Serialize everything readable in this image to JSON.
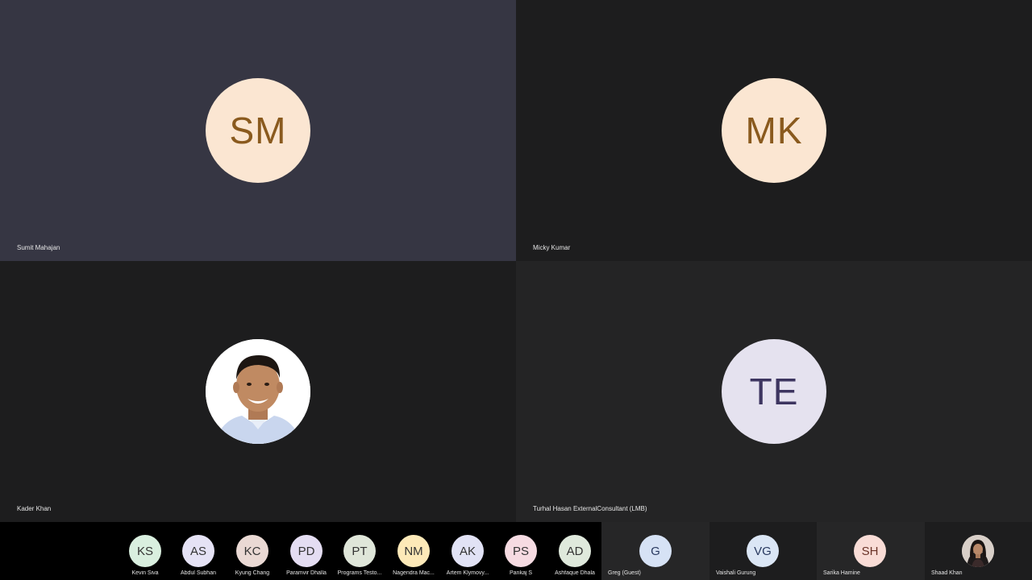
{
  "main_tiles": [
    {
      "initials": "SM",
      "name": "Sumit Mahajan",
      "tile_bg": "#363643",
      "avatar_bg": "#fbe6d2",
      "text_color": "#8a5a1e"
    },
    {
      "initials": "MK",
      "name": "Micky Kumar",
      "tile_bg": "#1d1d1e",
      "avatar_bg": "#fbe6d2",
      "text_color": "#8a5a1e"
    },
    {
      "initials": "",
      "name": "Kader Khan",
      "tile_bg": "#1d1d1e",
      "avatar_bg": "#ffffff",
      "has_photo": true
    },
    {
      "initials": "TE",
      "name": "Turhal Hasan ExternalConsultant (LMB)",
      "tile_bg": "#242425",
      "avatar_bg": "#e5e2ef",
      "text_color": "#3d3560"
    }
  ],
  "strip_chips": [
    {
      "initials": "KS",
      "name": "Kevin Siva",
      "bg": "#d9efdf"
    },
    {
      "initials": "AS",
      "name": "Abdul Subhan",
      "bg": "#e5e2f5"
    },
    {
      "initials": "KC",
      "name": "Kyung Chang",
      "bg": "#ead9d4"
    },
    {
      "initials": "PD",
      "name": "Paramvir Dhalla",
      "bg": "#e4ddf2"
    },
    {
      "initials": "PT",
      "name": "Programs Testo...",
      "bg": "#dfe6d9"
    },
    {
      "initials": "NM",
      "name": "Nagendra Mac...",
      "bg": "#fde9b8"
    },
    {
      "initials": "AK",
      "name": "Artem Klymovy...",
      "bg": "#e1e2f5"
    },
    {
      "initials": "PS",
      "name": "Pankaj S",
      "bg": "#f6dbe2"
    },
    {
      "initials": "AD",
      "name": "Ashfaque Dhala",
      "bg": "#dfe9dc"
    }
  ],
  "side_panels": [
    {
      "initials": "G",
      "name": "Greg (Guest)",
      "panel_bg": "#262627",
      "bg": "#d6e2f5",
      "text_color": "#2a3a60"
    },
    {
      "initials": "VG",
      "name": "Vaishali Gurung",
      "panel_bg": "#1d1d1e",
      "bg": "#dbe6f5",
      "text_color": "#2a3a60"
    },
    {
      "initials": "SH",
      "name": "Sarika Hamine",
      "panel_bg": "#262627",
      "bg": "#f9dcd6",
      "text_color": "#6a3328"
    },
    {
      "initials": "",
      "name": "Shaad Khan",
      "panel_bg": "#1d1d1e",
      "bg": "#d8cfc8",
      "has_photo": true
    }
  ]
}
